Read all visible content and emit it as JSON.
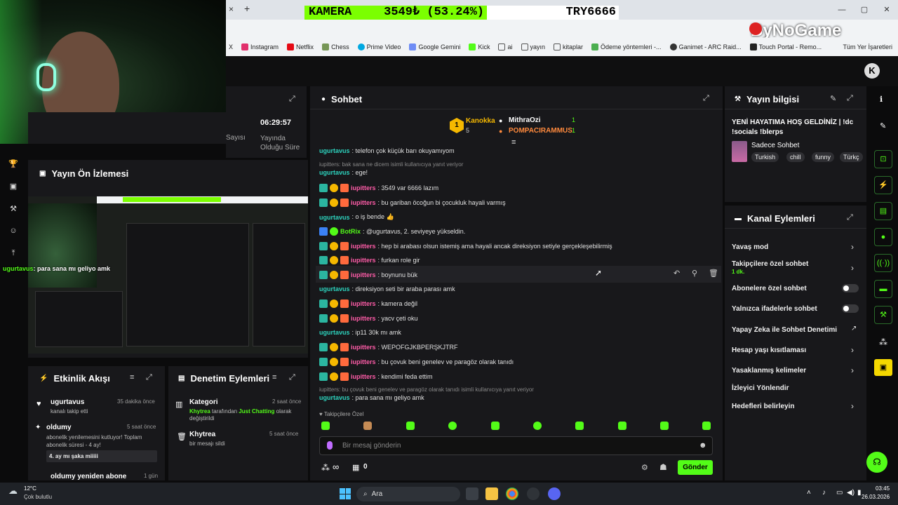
{
  "browser": {
    "tab_close": "×",
    "tab_new": "+",
    "ticker": {
      "label": "KAMERA",
      "value": "3549₺ (53.24%)",
      "target": "TRY6666"
    },
    "window_controls": [
      "—",
      "▢",
      "✕"
    ],
    "bookmarks": [
      "X",
      "Instagram",
      "Netflix",
      "Chess",
      "Prime Video",
      "Google Gemini",
      "Kick",
      "ai",
      "yayın",
      "kitaplar",
      "Ödeme yöntemleri -...",
      "Ganimet - ARC Raid...",
      "Touch Portal - Remo..."
    ],
    "all_bookmarks": "Tüm Yer İşaretleri",
    "logo": "ByNoGame"
  },
  "left": {
    "stats": {
      "viewers_label": "Sayısı",
      "duration_value": "06:29:57",
      "duration_label": "Yayında Olduğu Süre"
    },
    "preview": {
      "title": "Yayın Ön İzlemesi",
      "overlay_user": "ugurtavus",
      "overlay_text": ": para sana mı geliyo amk"
    },
    "activity": {
      "title": "Etkinlik Akışı",
      "items": [
        {
          "user": "ugurtavus",
          "time": "35 dakika önce",
          "text": "kanalı takip etti"
        },
        {
          "user": "oldumy",
          "time": "5 saat önce",
          "text": "abonelik yenilemesini kutluyor! Toplam abonelik süresi - 4 ay!",
          "note": "4. ay mı şaka miiiii"
        },
        {
          "user": "oldumy yeniden abone",
          "time": "1 gün",
          "text": ""
        }
      ]
    },
    "moderation": {
      "title": "Denetim Eylemleri",
      "items": [
        {
          "title": "Kategori",
          "time": "2 saat önce",
          "actor": "Khytrea",
          "text_a": "tarafından",
          "value": "Just Chatting",
          "text_b": "olarak değiştirildi"
        },
        {
          "title": "Khytrea",
          "time": "5 saat önce",
          "text": "bir mesajı sildi"
        }
      ]
    }
  },
  "chat": {
    "title": "Sohbet",
    "leaders": [
      {
        "rank": "1",
        "name": "Kanokka",
        "count": "5"
      },
      {
        "name": "MithraOzi",
        "count": "1"
      },
      {
        "name": "POMPACIRAMMUS",
        "count": "1"
      }
    ],
    "messages": [
      {
        "user": "ugurtavus",
        "color": "green",
        "text": ": telefon çok küçük barı okuyamıyom",
        "badges": []
      },
      {
        "reply": "iupitters: bak sana ne dicem isimli kullanıcıya yanıt veriyor"
      },
      {
        "user": "ugurtavus",
        "color": "green",
        "text": ": ege!",
        "badges": []
      },
      {
        "user": "iupitters",
        "color": "pink",
        "text": ": 3549 var 6666 lazım",
        "badges": [
          "sub",
          "gold",
          "k"
        ]
      },
      {
        "user": "iupitters",
        "color": "pink",
        "text": ": bu gariban öcoğun bi çocukluk hayali varmış",
        "badges": [
          "sub",
          "gold",
          "k"
        ]
      },
      {
        "user": "ugurtavus",
        "color": "green",
        "text": ": o iş bende 👍",
        "badges": []
      },
      {
        "user": "BotRix",
        "color": "green",
        "text": ": @ugurtavus, 2. seviyeye yükseldin.",
        "badges": [
          "bot",
          "check"
        ]
      },
      {
        "user": "iupitters",
        "color": "pink",
        "text": ": hep bi arabası olsun istemiş ama hayali ancak direksiyon setiyle gerçekleşebilirmiş",
        "badges": [
          "sub",
          "gold",
          "k"
        ]
      },
      {
        "user": "iupitters",
        "color": "pink",
        "text": ": furkan role gir",
        "badges": [
          "sub",
          "gold",
          "k"
        ]
      },
      {
        "user": "iupitters",
        "color": "pink",
        "text": ": boynunu bük",
        "badges": [
          "sub",
          "gold",
          "k"
        ]
      },
      {
        "user": "ugurtavus",
        "color": "green",
        "text": ": direksiyon seti bir araba parası amk",
        "badges": []
      },
      {
        "user": "iupitters",
        "color": "pink",
        "text": ": kamera değil",
        "badges": [
          "sub",
          "gold",
          "k"
        ]
      },
      {
        "user": "iupitters",
        "color": "pink",
        "text": ": yacv çeti oku",
        "badges": [
          "sub",
          "gold",
          "k"
        ]
      },
      {
        "user": "ugurtavus",
        "color": "green",
        "text": ": ip11 30k mı amk",
        "badges": []
      },
      {
        "user": "iupitters",
        "color": "pink",
        "text": ": WEPOFGJKBPERŞKJTRF",
        "badges": [
          "sub",
          "gold",
          "k"
        ]
      },
      {
        "user": "iupitters",
        "color": "pink",
        "text": ": bu çovuk beni genelev ve paragöz olarak tanıdı",
        "badges": [
          "sub",
          "gold",
          "k"
        ]
      },
      {
        "user": "iupitters",
        "color": "pink",
        "text": ": kendimi feda ettim",
        "badges": [
          "sub",
          "gold",
          "k"
        ]
      },
      {
        "reply": "iupitters: bu çovuk beni genelev ve paragöz olarak tanıdı isimli kullanıcıya yanıt veriyor"
      },
      {
        "user": "ugurtavus",
        "color": "green",
        "text": ": para sana mı geliyo amk",
        "badges": []
      }
    ],
    "followers_only": "Takipçilere Özel",
    "input_placeholder": "Bir mesaj gönderin",
    "points": "∞",
    "gift_count": "0",
    "send_label": "Gönder"
  },
  "info": {
    "title": "Yayın bilgisi",
    "stream_title": "YENİ HAYATIMA HOŞ GELDİNİZ | !dc !socials !blerps",
    "category": "Sadece Sohbet",
    "tags": [
      "Turkish",
      "chill",
      "funny",
      "Türkç"
    ]
  },
  "actions": {
    "title": "Kanal Eylemleri",
    "items": [
      {
        "label": "Yavaş mod",
        "kind": "chevron"
      },
      {
        "label": "Takipçilere özel sohbet",
        "sub": "1 dk.",
        "kind": "chevron"
      },
      {
        "label": "Abonelere özel sohbet",
        "kind": "toggle"
      },
      {
        "label": "Yalnızca ifadelerle sohbet",
        "kind": "toggle"
      },
      {
        "label": "Yapay Zeka ile Sohbet Denetimi",
        "kind": "external"
      },
      {
        "label": "Hesap yaşı kısıtlaması",
        "kind": "chevron"
      },
      {
        "label": "Yasaklanmış kelimeler",
        "kind": "chevron"
      },
      {
        "label": "İzleyici Yönlendir",
        "kind": "none"
      },
      {
        "label": "Hedefleri belirleyin",
        "kind": "chevron"
      }
    ]
  },
  "taskbar": {
    "weather_temp": "12°C",
    "weather_text": "Çok bulutlu",
    "search": "Ara",
    "time": "03:45",
    "date": "26.03.2026"
  }
}
